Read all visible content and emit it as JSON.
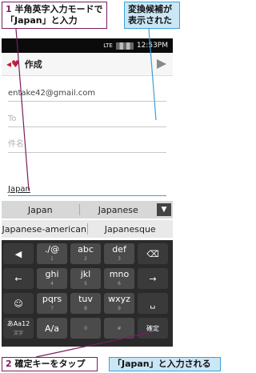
{
  "callouts": {
    "step1": {
      "num": "1",
      "line1": "半角英字入力モードで",
      "line2": "「Japan」と入力"
    },
    "candidates_note": {
      "line1": "変換候補が",
      "line2": "表示された"
    },
    "step2": {
      "num": "2",
      "text": "確定キーをタップ"
    },
    "result_note": {
      "text": "「Japan」と入力される"
    }
  },
  "phone": {
    "status": {
      "lte": "LTE",
      "time": "12:53PM"
    },
    "actionbar": {
      "title": "作成"
    },
    "fields": {
      "from": "entake42@gmail.com",
      "to_placeholder": "To",
      "subject_placeholder": "件名"
    },
    "compose_text": "Japan",
    "candidates_row1": [
      "Japan",
      "Japanese"
    ],
    "candidates_row2": [
      "Japanese-american",
      "Japanesque"
    ],
    "keyboard": {
      "row1": [
        {
          "main": "./@",
          "sub": "1"
        },
        {
          "main": "abc",
          "sub": "2"
        },
        {
          "main": "def",
          "sub": "3"
        }
      ],
      "row2": [
        {
          "main": "ghi",
          "sub": "4"
        },
        {
          "main": "jkl",
          "sub": "5"
        },
        {
          "main": "mno",
          "sub": "6"
        }
      ],
      "row3": [
        {
          "main": "pqrs",
          "sub": "7"
        },
        {
          "main": "tuv",
          "sub": "8"
        },
        {
          "main": "wxyz",
          "sub": "9"
        }
      ],
      "row4": [
        {
          "main": "A/a",
          "sub": ""
        },
        {
          "main": "",
          "sub": "0"
        },
        {
          "main": "",
          "sub": "#"
        }
      ],
      "mode_key": {
        "line1": "あAa12",
        "line2": "文字"
      },
      "enter_label": "確定"
    }
  }
}
